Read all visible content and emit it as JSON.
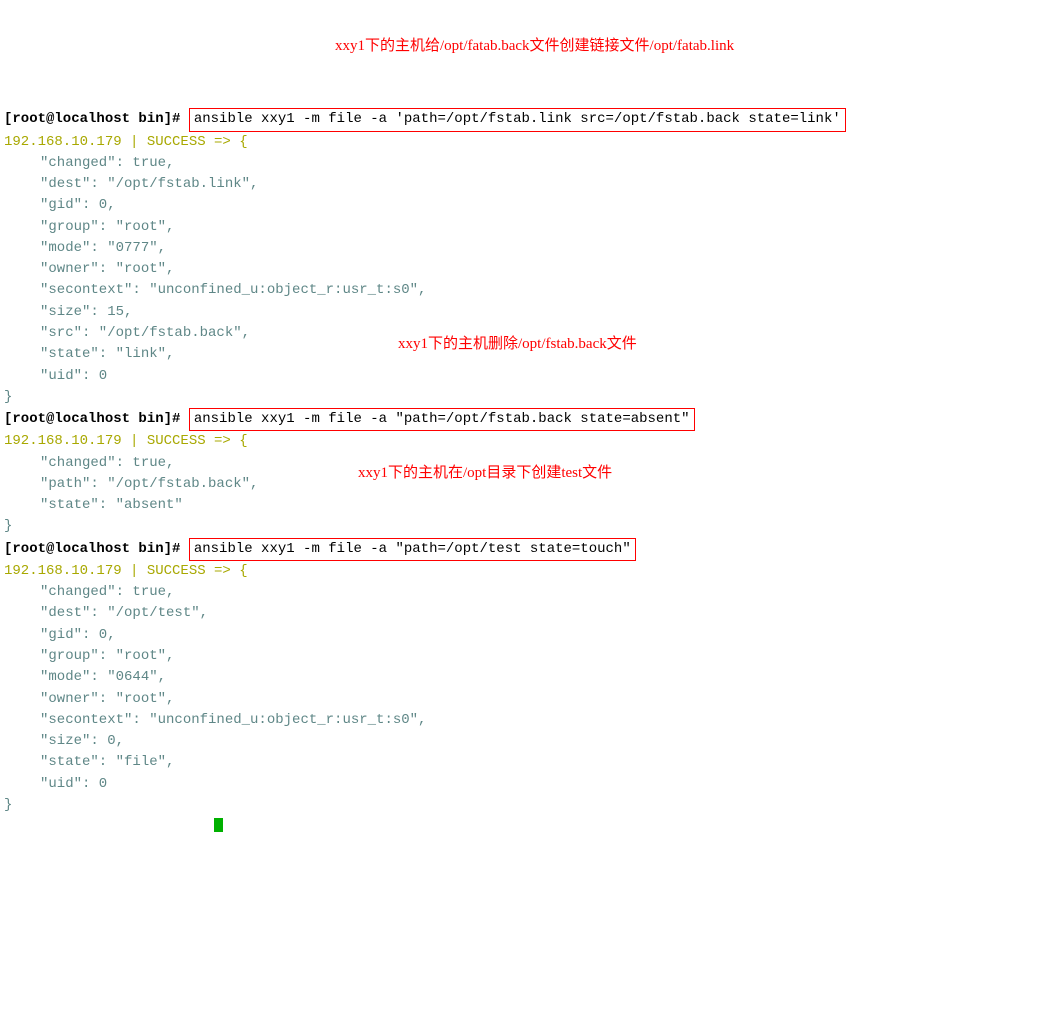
{
  "block1": {
    "prompt": "[root@localhost bin]# ",
    "cmd": "ansible xxy1 -m file -a 'path=/opt/fstab.link src=/opt/fstab.back state=link'",
    "success": "192.168.10.179 | SUCCESS => {",
    "lines": [
      "\"changed\": true,",
      "\"dest\": \"/opt/fstab.link\",",
      "\"gid\": 0,",
      "\"group\": \"root\",",
      "\"mode\": \"0777\",",
      "\"owner\": \"root\",",
      "\"secontext\": \"unconfined_u:object_r:usr_t:s0\",",
      "\"size\": 15,",
      "\"src\": \"/opt/fstab.back\",",
      "\"state\": \"link\",",
      "\"uid\": 0"
    ],
    "close": "}",
    "annot": "xxy1下的主机给/opt/fatab.back文件创建链接文件/opt/fatab.link"
  },
  "block2": {
    "prompt": "[root@localhost bin]# ",
    "cmd": "ansible xxy1 -m file -a \"path=/opt/fstab.back state=absent\"",
    "success": "192.168.10.179 | SUCCESS => {",
    "lines": [
      "\"changed\": true,",
      "\"path\": \"/opt/fstab.back\",",
      "\"state\": \"absent\""
    ],
    "close": "}",
    "annot": "xxy1下的主机删除/opt/fstab.back文件"
  },
  "block3": {
    "prompt": "[root@localhost bin]# ",
    "cmd": "ansible xxy1 -m file -a \"path=/opt/test state=touch\"",
    "success": "192.168.10.179 | SUCCESS => {",
    "lines": [
      "\"changed\": true,",
      "\"dest\": \"/opt/test\",",
      "\"gid\": 0,",
      "\"group\": \"root\",",
      "\"mode\": \"0644\",",
      "\"owner\": \"root\",",
      "\"secontext\": \"unconfined_u:object_r:usr_t:s0\",",
      "\"size\": 0,",
      "\"state\": \"file\",",
      "\"uid\": 0"
    ],
    "close": "}",
    "annot": "xxy1下的主机在/opt目录下创建test文件"
  }
}
